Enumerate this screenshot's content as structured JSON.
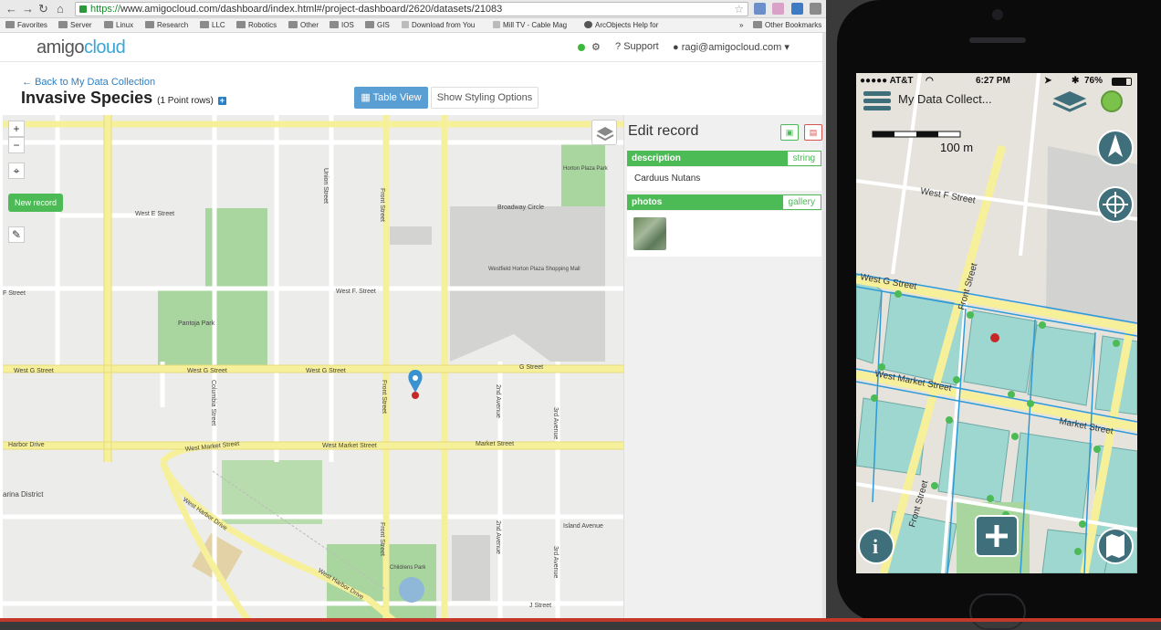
{
  "browser": {
    "url_scheme": "https://",
    "url_rest": "www.amigocloud.com/dashboard/index.html#/project-dashboard/2620/datasets/21083",
    "bookmarks": [
      "Favorites",
      "Server",
      "Linux",
      "Research",
      "LLC",
      "Robotics",
      "Other",
      "IOS",
      "GIS",
      "Download from You",
      "Mill TV - Cable Mag",
      "ArcObjects Help for",
      "»",
      "Other Bookmarks"
    ]
  },
  "header": {
    "logo_a": "amigo",
    "logo_b": "cloud",
    "support": "Support",
    "user": "ragi@amigocloud.com"
  },
  "page": {
    "back": "Back to My Data Collection",
    "title": "Invasive Species",
    "rows": "(1 Point rows)",
    "table_view": "Table View",
    "show_styling": "Show Styling Options"
  },
  "map": {
    "zoom_in": "+",
    "zoom_out": "−",
    "new_record": "New record",
    "labels": {
      "west_e": "West E Street",
      "f_street_left": "F Street",
      "west_f": "West F. Street",
      "union": "Union Street",
      "front1": "Front Street",
      "broadway": "Broadway Circle",
      "horton": "Horton Plaza Park",
      "westfield": "Westfield Horton Plaza Shopping Mall",
      "pantoja": "Pantoja Park",
      "west_g1": "West G Street",
      "west_g2": "West G Street",
      "west_g3": "West G Street",
      "g_street": "G Street",
      "columbia": "Columbia Street",
      "front2": "Front Street",
      "second_ave": "2nd Avenue",
      "third_ave": "3rd Avenue",
      "harbor1": "Harbor Drive",
      "west_market1": "West Market Street",
      "west_market2": "West Market Street",
      "market": "Market Street",
      "marina": "arina District",
      "west_harbor1": "West Harbor Drive",
      "front3": "Front Street",
      "second_ave2": "2nd Avenue",
      "third_ave2": "3rd Avenue",
      "island": "Island Avenue",
      "childrens": "Childrens Park",
      "west_harbor2": "West Harbor Drive",
      "j_street": "J Street"
    }
  },
  "edit": {
    "title": "Edit record",
    "field1_name": "description",
    "field1_type": "string",
    "field1_value": "Carduus Nutans",
    "field2_name": "photos",
    "field2_type": "gallery"
  },
  "phone": {
    "carrier": "●●●●● AT&T",
    "time": "6:27 PM",
    "battery": "76%",
    "title": "My Data Collect...",
    "scale": "100 m",
    "labels": {
      "west_f": "West F Street",
      "west_g": "West G Street",
      "front": "Front Street",
      "west_market": "West Market Street",
      "market": "Market Street",
      "front2": "Front Street"
    }
  },
  "colors": {
    "accent_green": "#4cba55",
    "accent_blue": "#5a9fd4",
    "road": "#f7f09a"
  }
}
